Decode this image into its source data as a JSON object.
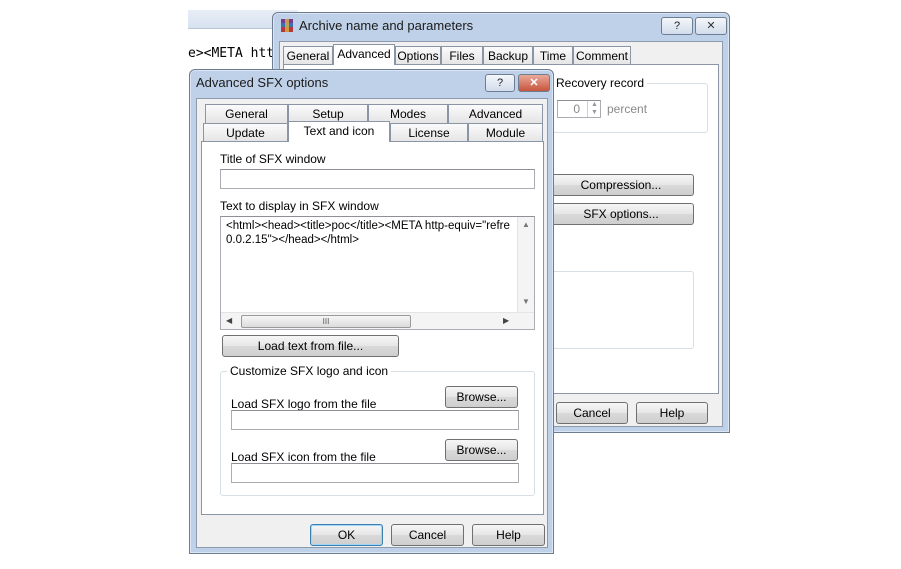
{
  "background_editor": {
    "code_fragment": "e><META htt"
  },
  "archive_window": {
    "title": "Archive name and parameters",
    "help_btn": "?",
    "close_btn": "✕",
    "tabs": [
      "General",
      "Advanced",
      "Options",
      "Files",
      "Backup",
      "Time",
      "Comment"
    ],
    "active_tab": "Advanced",
    "recovery_label": "Recovery record",
    "recovery_value": "0",
    "recovery_unit": "percent",
    "compression_btn": "Compression...",
    "sfx_options_btn": "SFX options...",
    "cancel_btn": "Cancel",
    "help_label": "Help"
  },
  "sfx_dialog": {
    "title": "Advanced SFX options",
    "help_btn": "?",
    "close_btn": "✕",
    "tabs_row1": [
      "General",
      "Setup",
      "Modes",
      "Advanced"
    ],
    "tabs_row2": [
      "Update",
      "Text and icon",
      "License",
      "Module"
    ],
    "active_tab": "Text and icon",
    "title_label": "Title of SFX window",
    "title_value": "",
    "text_label": "Text to display in SFX window",
    "text_line1": "<html><head><title>poc</title><META http-equiv=\"refre",
    "text_line2": "0.0.2.15\"></head></html>",
    "hscroll_grip": "III",
    "load_text_btn": "Load text from file...",
    "group_title": "Customize SFX logo and icon",
    "logo_label": "Load SFX logo from the file",
    "logo_browse": "Browse...",
    "logo_value": "",
    "icon_label": "Load SFX icon from the file",
    "icon_browse": "Browse...",
    "icon_value": "",
    "ok_btn": "OK",
    "cancel_btn": "Cancel",
    "help_label": "Help"
  }
}
